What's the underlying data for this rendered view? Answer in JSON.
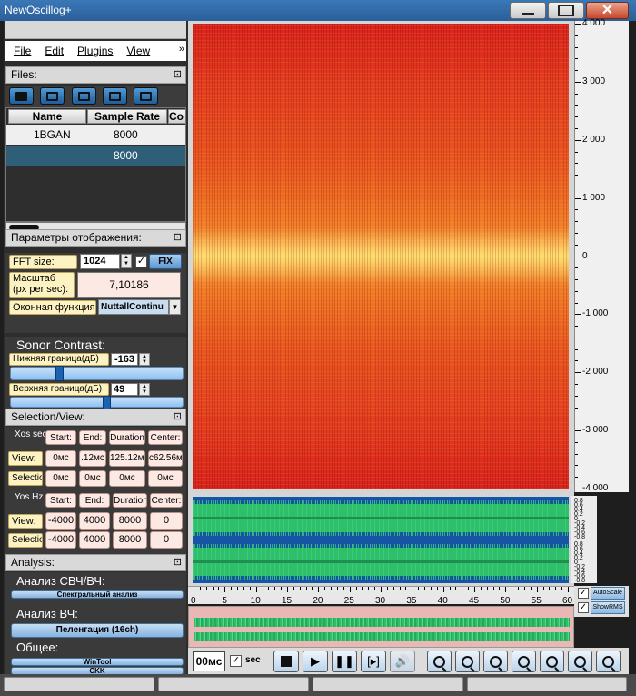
{
  "window": {
    "title": "NewOscillog+"
  },
  "menu": {
    "items": [
      "File",
      "Edit",
      "Plugins",
      "View"
    ],
    "more": "»"
  },
  "files": {
    "header": "Files:",
    "columns": [
      "Name",
      "Sample Rate",
      "Co"
    ],
    "rows": [
      {
        "name": "1BGAN",
        "rate": "8000"
      },
      {
        "name": "",
        "rate": "8000"
      }
    ]
  },
  "display": {
    "header": "Параметры отображения:",
    "fft_label": "FFT size:",
    "fft_value": "1024",
    "fix_label": "FIX",
    "scale_label": "Масштаб\n(px per sec):",
    "scale_value": "7,10186",
    "window_label": "Оконная функция:",
    "window_value": "NuttallContinu"
  },
  "contrast": {
    "title": "Sonor Contrast:",
    "lower_label": "Нижняя граница(дБ)",
    "lower_value": "-163",
    "upper_label": "Верхняя граница(дБ)",
    "upper_value": "49",
    "lower_level": 0.27,
    "upper_level": 0.56
  },
  "selection": {
    "header": "Selection/View:",
    "xos_label": "Xos sec",
    "x_cols": [
      "Start:",
      "End:",
      "Duration",
      "Center:"
    ],
    "x_view": [
      "0мс",
      ".12мс",
      "125.12мс",
      "c62.56мс"
    ],
    "x_sel": [
      "0мс",
      "0мс",
      "0мс",
      "0мс"
    ],
    "yos_label": "Yos Hz",
    "y_cols": [
      "Start:",
      "End:",
      "Duration",
      "Center:"
    ],
    "y_view": [
      "-4000",
      "4000",
      "8000",
      "0"
    ],
    "y_sel": [
      "-4000",
      "4000",
      "8000",
      "0"
    ],
    "view_label": "View:",
    "sel_label": "Selection",
    "sel_label_y": "Selection"
  },
  "analysis": {
    "header": "Analysis:",
    "svch_title": "Анализ СВЧ/ВЧ:",
    "svch_btn": "Спектральный анализ",
    "vch_title": "Анализ ВЧ:",
    "vch_btn": "Пеленгация (16ch)",
    "common_title": "Общее:",
    "common_btn1": "WinTool",
    "common_btn2": "CKK"
  },
  "spectrogram": {
    "y_labels": [
      "4 000",
      "3 000",
      "2 000",
      "1 000",
      "0",
      "-1 000",
      "-2 000",
      "-3 000",
      "-4 000"
    ]
  },
  "waveform": {
    "labels": [
      "0.8",
      "0.6",
      "0.4",
      "0.2",
      "0",
      "-0.2",
      "-0.4",
      "-0.6",
      "-0.8"
    ]
  },
  "time_axis": {
    "ticks": [
      "0",
      "5",
      "10",
      "15",
      "20",
      "25",
      "30",
      "35",
      "40",
      "45",
      "50",
      "55",
      "60"
    ]
  },
  "controls": {
    "autoscale": "AutoScale",
    "showrms": "ShowRMS",
    "time_value": "00мс",
    "sec_label": "sec"
  },
  "colors": {
    "accent": "#1b63b0",
    "spectro_hot": "#f59a3a",
    "spectro_base": "#d8221b",
    "wave_bg": "#1555a3",
    "wave_fg": "#2fbf6a"
  },
  "icons": [
    "folder-open-icon",
    "add-file-icon",
    "export-icon",
    "trash-icon",
    "import-icon",
    "stop-icon",
    "play-icon",
    "pause-icon",
    "loop-icon",
    "volume-icon",
    "zoom-in-icon",
    "zoom-out-icon",
    "zoom-fit-icon",
    "zoom-in-horizontal-icon",
    "zoom-out-horizontal-icon",
    "zoom-in-vertical-icon",
    "zoom-out-vertical-icon"
  ]
}
